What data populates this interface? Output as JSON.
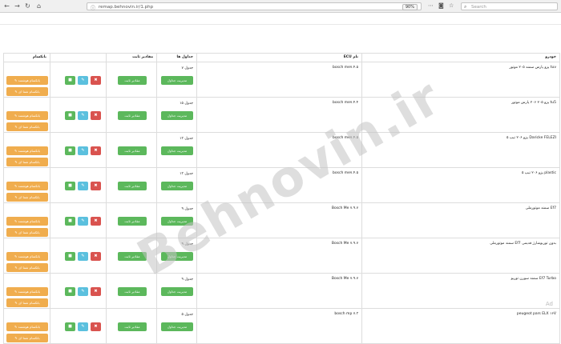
{
  "browser": {
    "url": "remap.behnovin.ir/1.php",
    "zoom": "90%",
    "search_placeholder": "Search",
    "icons": [
      "back-arrow-icon",
      "forward-arrow-icon",
      "reload-icon",
      "home-icon",
      "page-info-icon",
      "more-icon",
      "pocket-icon",
      "bookmark-star-icon",
      "search-icon"
    ]
  },
  "table": {
    "headers": {
      "actions": "بانکسام",
      "value": "مقادیر ثابت",
      "tables": "جداول ها",
      "ecu": "ECU نام",
      "vehicle": "خودرو"
    },
    "rows": [
      {
        "vehicle": "پژو پارس سمند ۲۰۵ موتور tuv",
        "ecu": "bosch me۷.۴.۵",
        "tables": "۷ جدول"
      },
      {
        "vehicle": "پژو ۲۰۵ ۲۰۶ پارس موتور tu5",
        "ecu": "bosch me۷.۴.۴",
        "tables": "۱۵ جدول"
      },
      {
        "vehicle": "پژو ۲۰۶ تیپ ۵ Daricke FELEZI",
        "ecu": "bosch me۷.۴.۵",
        "tables": "۱۳ جدول"
      },
      {
        "vehicle": "پژو ۲۰۶ تیپ ۵ plastic",
        "ecu": "bosch me۷.۴.۵",
        "tables": "۱۳ جدول"
      },
      {
        "vehicle": "سمند موتورملی Ef7",
        "ecu": "Bosch Me ۷.۹.۷",
        "tables": "۹ جدول"
      },
      {
        "vehicle": "سمند موتورملی Ef7 بدون توربوشارژ قدیمی",
        "ecu": "Bosch Me ۷.۹.۷",
        "tables": "۹ جدول"
      },
      {
        "vehicle": "سمند سورن توربو Ef7 Turbo",
        "ecu": "Bosch Me ۷.۹.۷",
        "tables": "۹ جدول"
      },
      {
        "vehicle": "peugeot pars ELX ۱۶V",
        "ecu": "bosch mp ۷.۳",
        "tables": "۵ جدول"
      }
    ],
    "row_buttons": {
      "program_button": "✎ بانکسام هوشمند",
      "bank_button": "✎ بانکسام شما ای",
      "value_button": "مقادیر ثابت",
      "manage_button": "مدیریت جداول",
      "save_glyph": "■",
      "edit_glyph": "✎",
      "delete_glyph": "✖"
    }
  },
  "watermark": "Behnovin.ir",
  "corner_hint": "Ad",
  "colors": {
    "orange": "#f0ad4e",
    "green": "#5cb85c",
    "blue": "#5bc0de",
    "red": "#d9534f"
  }
}
